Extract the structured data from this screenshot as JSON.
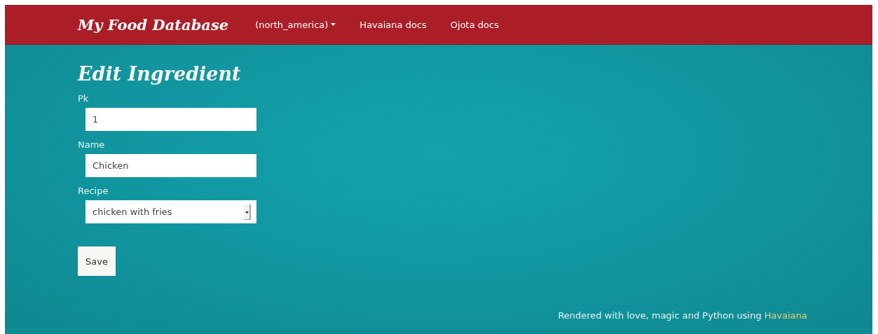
{
  "navbar": {
    "brand": "My Food Database",
    "menu": [
      {
        "kind": "dropdown",
        "label": "(north_america)"
      },
      {
        "kind": "link",
        "label": "Havaiana docs"
      },
      {
        "kind": "link",
        "label": "Ojota docs"
      }
    ]
  },
  "page_title": "Edit Ingredient",
  "form": {
    "fields": [
      {
        "kind": "input",
        "label": "Pk",
        "value": "1"
      },
      {
        "kind": "input",
        "label": "Name",
        "value": "Chicken"
      },
      {
        "kind": "select",
        "label": "Recipe",
        "value": "chicken with fries"
      }
    ],
    "submit": "Save"
  },
  "footer": {
    "text": "Rendered with love, magic and Python using",
    "link": "Havaiana"
  }
}
